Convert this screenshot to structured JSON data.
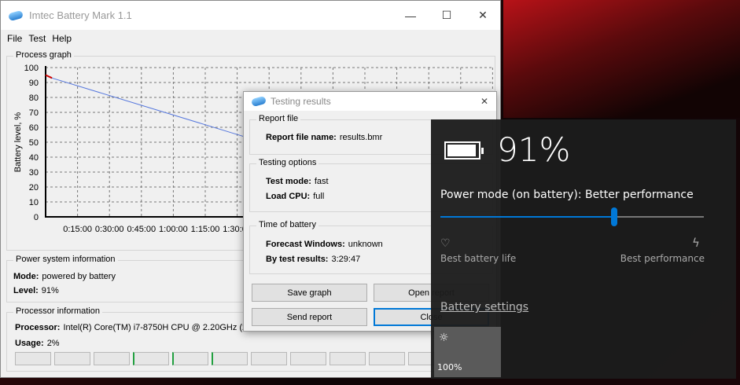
{
  "window": {
    "title": "Imtec Battery Mark 1.1",
    "minimize": "—",
    "maximize": "☐",
    "close": "✕"
  },
  "menu": [
    "File",
    "Test",
    "Help"
  ],
  "graph": {
    "group_label": "Process graph",
    "ylabel": "Battery level, %",
    "yticks": [
      "0",
      "10",
      "20",
      "30",
      "40",
      "50",
      "60",
      "70",
      "80",
      "90",
      "100"
    ],
    "xticks": [
      "0:15:00",
      "0:30:00",
      "0:45:00",
      "1:00:00",
      "1:15:00",
      "1:30:00"
    ],
    "series_minutes": [
      0,
      3,
      95
    ],
    "series_level": [
      95,
      93,
      53
    ],
    "line_color": "#5577dd",
    "start_color": "#cc0000"
  },
  "power": {
    "group_label": "Power system information",
    "mode_label": "Mode:",
    "mode": "powered by battery",
    "level_label": "Level:",
    "level": "91%"
  },
  "processor": {
    "group_label": "Processor information",
    "proc_label": "Processor:",
    "proc": "Intel(R) Core(TM) i7-8750H CPU @ 2.20GHz  (2",
    "usage_label": "Usage:",
    "usage": "2%"
  },
  "dialog": {
    "title": "Testing results",
    "close": "✕",
    "report_group": "Report file",
    "report_label": "Report file name:",
    "report_value": "results.bmr",
    "options_group": "Testing options",
    "mode_label": "Test mode:",
    "mode_value": "fast",
    "cpu_label": "Load CPU:",
    "cpu_value": "full",
    "time_group": "Time of battery",
    "forecast_label": "Forecast Windows:",
    "forecast_value": "unknown",
    "test_label": "By test results:",
    "test_value": "3:29:47",
    "save_graph": "Save graph",
    "open_report": "Open report",
    "send_report": "Send report",
    "close_btn": "Close"
  },
  "flyout": {
    "percent": "91%",
    "power_mode": "Power mode (on battery): Better performance",
    "slider_value": 0.66,
    "left_label": "Best battery life",
    "right_label": "Best performance",
    "settings_link": "Battery settings",
    "brightness": "100%",
    "accent": "#0078d7"
  }
}
